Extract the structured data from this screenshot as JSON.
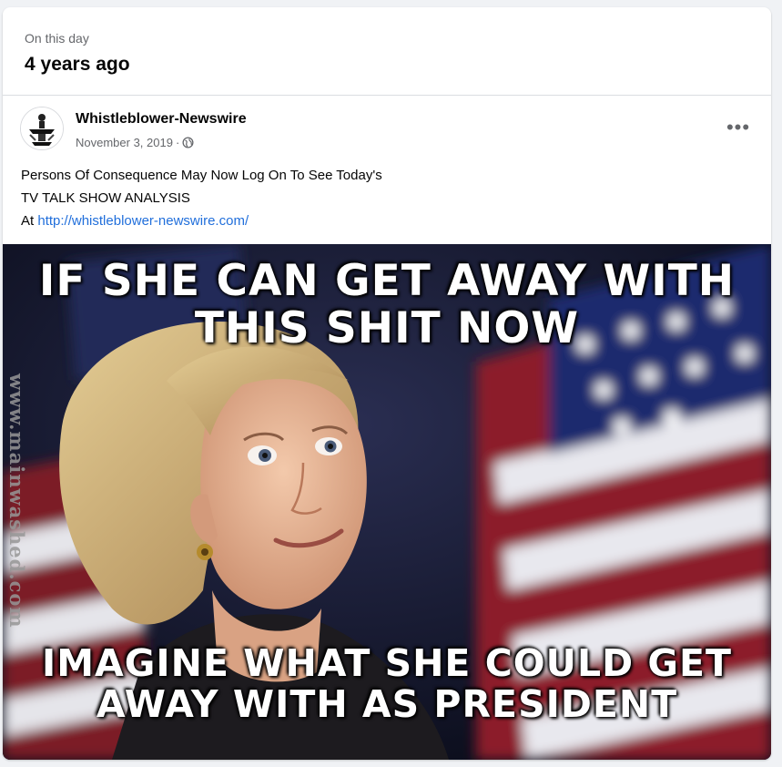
{
  "memories": {
    "caption": "On this day",
    "title": "4 years ago"
  },
  "post": {
    "author": "Whistleblower-Newswire",
    "date": "November 3, 2019",
    "privacy_icon": "globe-icon",
    "more_icon": "more-options-icon",
    "text_line1": "Persons Of Consequence May Now Log On To See Today's",
    "text_line2": "TV TALK SHOW ANALYSIS",
    "text_prefix": "At",
    "link": "http://whistleblower-newswire.com/"
  },
  "image": {
    "top_caption": "IF SHE CAN GET AWAY WITH THIS SHIT NOW",
    "bottom_caption": "IMAGINE WHAT SHE COULD GET AWAY WITH AS PRESIDENT",
    "watermark": "www.mainwashed.com"
  },
  "colors": {
    "link": "#216fdb",
    "muted_text": "#65676b",
    "card_background": "#ffffff",
    "page_background": "#f0f2f5"
  }
}
